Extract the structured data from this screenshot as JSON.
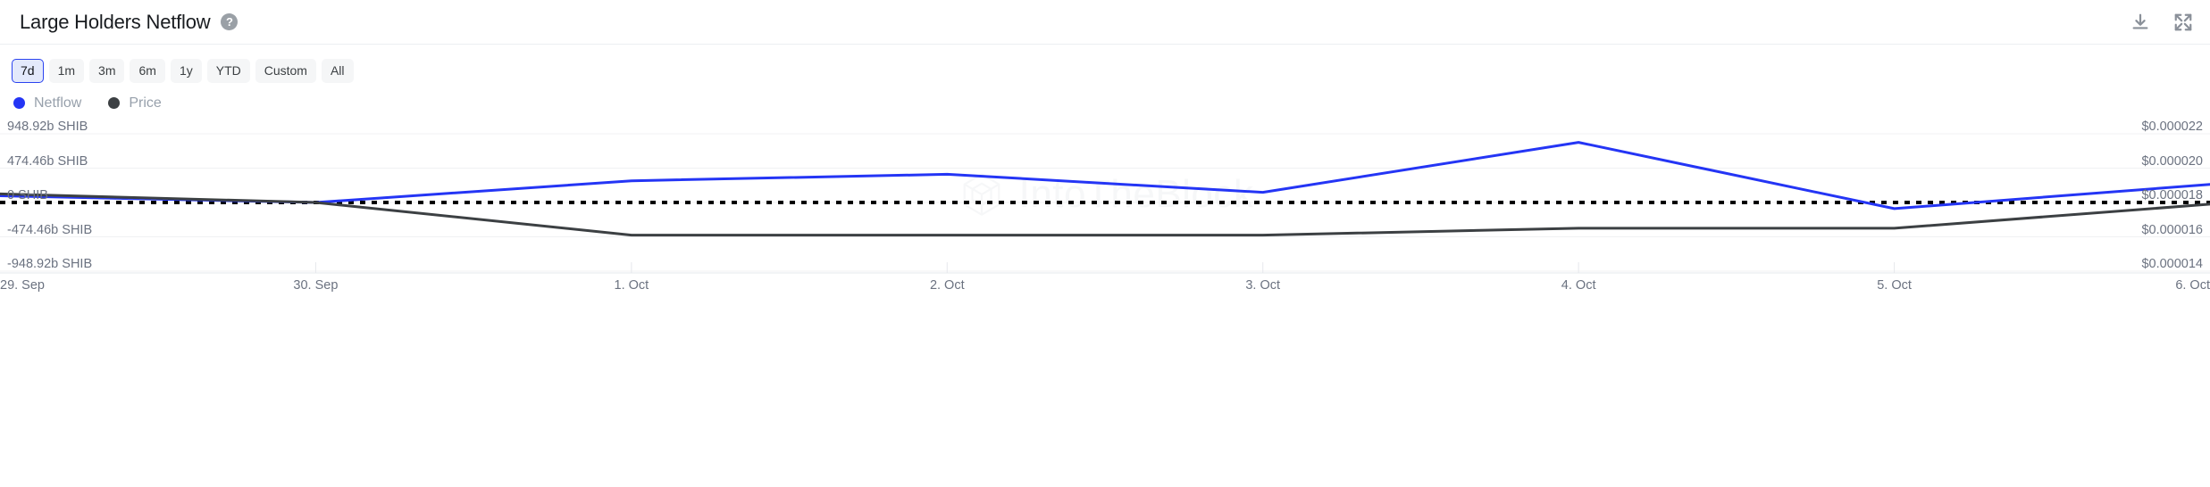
{
  "header": {
    "title": "Large Holders Netflow",
    "help_icon": "question-mark-circle-icon",
    "download_icon": "download-icon",
    "fullscreen_icon": "fullscreen-expand-icon"
  },
  "ranges": {
    "selected": "7d",
    "options": [
      "7d",
      "1m",
      "3m",
      "6m",
      "1y",
      "YTD",
      "Custom",
      "All"
    ]
  },
  "legend": [
    {
      "label": "Netflow",
      "color": "#2435f5"
    },
    {
      "label": "Price",
      "color": "#3c4043"
    }
  ],
  "watermark": {
    "text": "IntoTheBlock"
  },
  "chart_data": {
    "type": "line",
    "title": "Large Holders Netflow",
    "x": [
      "29. Sep",
      "30. Sep",
      "1. Oct",
      "2. Oct",
      "3. Oct",
      "4. Oct",
      "5. Oct",
      "6. Oct"
    ],
    "xlabel": "",
    "grid": true,
    "legend_position": "top-left",
    "axes": [
      {
        "id": "left",
        "name": "Netflow",
        "ylabel": "SHIB",
        "ticks": [
          "948.92b SHIB",
          "474.46b SHIB",
          "0 SHIB",
          "-474.46b SHIB",
          "-948.92b SHIB"
        ],
        "tick_values": [
          948.92,
          474.46,
          0,
          -474.46,
          -948.92
        ],
        "ylim": [
          -948.92,
          948.92
        ],
        "units": "billions SHIB"
      },
      {
        "id": "right",
        "name": "Price",
        "ylabel": "USD",
        "ticks": [
          "$0.000022",
          "$0.000020",
          "$0.000018",
          "$0.000016",
          "$0.000014"
        ],
        "tick_values": [
          2.2e-05,
          2e-05,
          1.8e-05,
          1.6e-05,
          1.4e-05
        ],
        "ylim": [
          1.4e-05,
          2.2e-05
        ]
      }
    ],
    "zero_line": {
      "value": 0,
      "style": "dotted",
      "color": "#000000"
    },
    "series": [
      {
        "name": "Netflow",
        "color": "#2435f5",
        "axis": "left",
        "values": [
          92,
          0,
          300,
          390,
          140,
          830,
          -85,
          250
        ]
      },
      {
        "name": "Price",
        "color": "#3c4043",
        "axis": "right",
        "values": [
          1.85e-05,
          1.8e-05,
          1.61e-05,
          1.61e-05,
          1.61e-05,
          1.65e-05,
          1.65e-05,
          1.79e-05
        ]
      }
    ]
  }
}
